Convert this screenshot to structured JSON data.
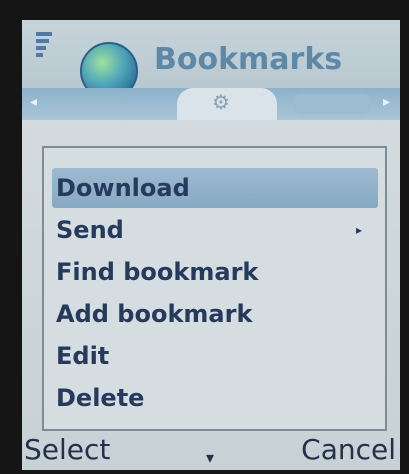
{
  "header": {
    "title": "Bookmarks",
    "icon": "globe-icon"
  },
  "tabs": {
    "left_arrow": "◂",
    "right_arrow": "▸",
    "active_icon": "⚙"
  },
  "menu": {
    "items": [
      {
        "label": "Download",
        "selected": true,
        "has_submenu": false
      },
      {
        "label": "Send",
        "selected": false,
        "has_submenu": true
      },
      {
        "label": "Find bookmark",
        "selected": false,
        "has_submenu": false
      },
      {
        "label": "Add bookmark",
        "selected": false,
        "has_submenu": false
      },
      {
        "label": "Edit",
        "selected": false,
        "has_submenu": false
      },
      {
        "label": "Delete",
        "selected": false,
        "has_submenu": false
      }
    ],
    "submenu_arrow": "▸"
  },
  "softkeys": {
    "left": "Select",
    "middle": "▾",
    "right": "Cancel"
  },
  "colors": {
    "menu_text": "#253a5c",
    "title": "#5e88a8",
    "highlight": "#86a9c3"
  }
}
